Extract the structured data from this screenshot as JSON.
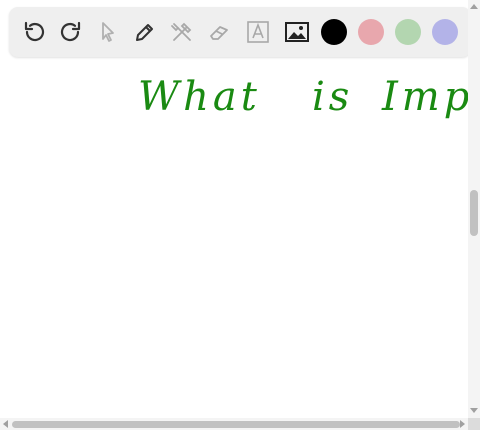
{
  "toolbar": {
    "tools": [
      {
        "name": "undo-icon",
        "enabled": true
      },
      {
        "name": "redo-icon",
        "enabled": true
      },
      {
        "name": "select-pointer-icon",
        "enabled": false
      },
      {
        "name": "pen-icon",
        "enabled": true
      },
      {
        "name": "tools-icon",
        "enabled": false
      },
      {
        "name": "eraser-icon",
        "enabled": false
      },
      {
        "name": "text-icon",
        "enabled": false
      },
      {
        "name": "image-icon",
        "enabled": true
      }
    ],
    "colors": [
      "#000000",
      "#e8a7ad",
      "#b3d6b0",
      "#b3b3e8"
    ]
  },
  "canvas": {
    "handwriting": [
      "What",
      "is",
      "Imp"
    ],
    "ink_color": "#1a8a12"
  }
}
